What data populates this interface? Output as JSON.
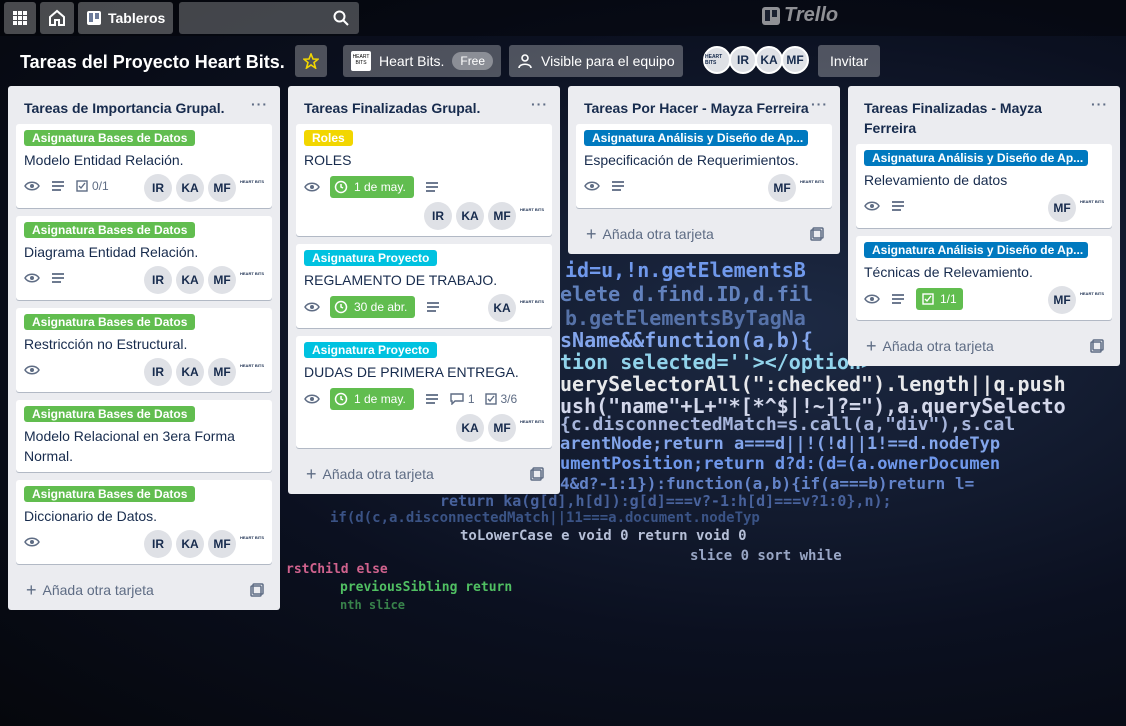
{
  "colors": {
    "green_label": "#61bd4f",
    "yellow_label": "#f2d600",
    "sky_label": "#00c2e0",
    "blue_label": "#0079bf",
    "due_complete": "#61bd4f"
  },
  "header": {
    "apps_icon": "grid-icon",
    "home_icon": "home-icon",
    "boards_label": "Tableros",
    "search_placeholder": "",
    "logo_text": "Trello"
  },
  "board": {
    "title": "Tareas del Proyecto Heart Bits.",
    "workspace_name": "Heart Bits.",
    "workspace_logo_text": "HEART BITS",
    "free_badge": "Free",
    "visibility_label": "Visible para el equipo",
    "members": [
      "IR",
      "KA",
      "MF"
    ],
    "invite_label": "Invitar"
  },
  "lists": [
    {
      "title": "Tareas de Importancia Grupal.",
      "add_label": "Añada otra tarjeta",
      "cards": [
        {
          "label": "Asignatura Bases de Datos",
          "title": "Modelo Entidad Relación.",
          "checklist": "0/1",
          "members": [
            "IR",
            "KA",
            "MF"
          ]
        },
        {
          "label": "Asignatura Bases de Datos",
          "title": "Diagrama Entidad Relación.",
          "members": [
            "IR",
            "KA",
            "MF"
          ]
        },
        {
          "label": "Asignatura Bases de Datos",
          "title": "Restricción no Estructural.",
          "members": [
            "IR",
            "KA",
            "MF"
          ]
        },
        {
          "label": "Asignatura Bases de Datos",
          "title_line1": "Modelo Relacional en 3era Forma",
          "title_line2": "Normal."
        },
        {
          "label": "Asignatura Bases de Datos",
          "title": "Diccionario de Datos.",
          "members": [
            "IR",
            "KA",
            "MF"
          ]
        }
      ]
    },
    {
      "title": "Tareas Finalizadas Grupal.",
      "add_label": "Añada otra tarjeta",
      "cards": [
        {
          "label": "Roles",
          "title": "ROLES",
          "due": "1 de may.",
          "members": [
            "IR",
            "KA",
            "MF"
          ]
        },
        {
          "label": "Asignatura Proyecto",
          "title": "REGLAMENTO DE TRABAJO.",
          "due": "30 de abr.",
          "members": [
            "KA"
          ]
        },
        {
          "label": "Asignatura Proyecto",
          "title": "DUDAS DE PRIMERA ENTREGA.",
          "due": "1 de may.",
          "comments": "1",
          "checklist": "3/6",
          "members": [
            "KA",
            "MF"
          ]
        }
      ]
    },
    {
      "title": "Tareas Por Hacer - Mayza Ferreira",
      "add_label": "Añada otra tarjeta",
      "cards": [
        {
          "label": "Asignatura Análisis y Diseño de Ap...",
          "title": "Especificación de Requerimientos.",
          "members": [
            "MF"
          ]
        }
      ]
    },
    {
      "title_line1": "Tareas Finalizadas - Mayza",
      "title_line2": "Ferreira",
      "add_label": "Añada otra tarjeta",
      "cards": [
        {
          "label": "Asignatura Análisis y Diseño de Ap...",
          "title": "Relevamiento de datos",
          "members": [
            "MF"
          ]
        },
        {
          "label": "Asignatura Análisis y Diseño de Ap...",
          "title": "Técnicas de Relevamiento.",
          "checklist": "1/1",
          "members": [
            "MF"
          ]
        }
      ]
    }
  ],
  "background_code": [
    "id=u,!n.getElementsB",
    "elete d.find.ID,d.fil",
    "b.getElementsByTagNa",
    "sName&&function(a,b){",
    "tion selected=''></option>",
    "uerySelectorAll(\":checked\").length||q.push",
    "ush(\"name\"+L+\"*[*^$|!~]?=\"),a.querySelecto",
    "{c.disconnectedMatch=s.call(a,\"div\"),s.cal",
    "arentNode;return a===d||!(!d||1!==d.nodeTyp",
    "umentPosition;return d?d:(d=(a.ownerDocumen",
    "4&d?-1:1}):function(a,b){if(a===b)return l=",
    "return ka(g[d],h[d]):g[d]===v?-1:h[d]===v?1:0},n);",
    "if(d(c,a.disconnectedMatch||11===a.document.nodeTyp",
    "toLowerCase e void 0 return void 0",
    "slice 0 sort while",
    "rstChild else",
    "previousSibling return",
    "nth slice"
  ]
}
